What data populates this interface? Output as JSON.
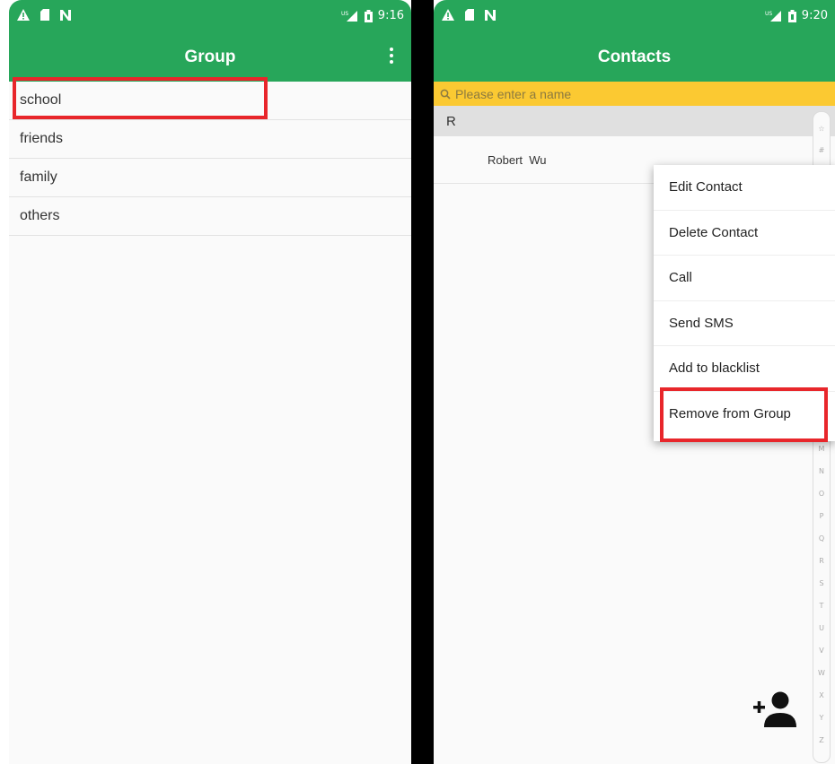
{
  "left_screen": {
    "status_bar": {
      "time": "9:16",
      "keyboard_indicator": "US",
      "icons": [
        "warning-icon",
        "sd-card-icon",
        "n-icon",
        "signal-icon",
        "battery-icon"
      ]
    },
    "app_bar": {
      "title": "Group",
      "menu_icon": "overflow-menu-icon"
    },
    "groups": [
      {
        "label": "school",
        "highlighted": true
      },
      {
        "label": "friends"
      },
      {
        "label": "family"
      },
      {
        "label": "others"
      }
    ]
  },
  "right_screen": {
    "status_bar": {
      "time": "9:20",
      "keyboard_indicator": "US"
    },
    "app_bar": {
      "title": "Contacts"
    },
    "search": {
      "placeholder": "Please enter a name"
    },
    "section_letter": "R",
    "contacts": [
      {
        "name": "Robert  Wu"
      }
    ],
    "context_menu": [
      {
        "label": "Edit Contact"
      },
      {
        "label": "Delete Contact"
      },
      {
        "label": "Call"
      },
      {
        "label": "Send SMS"
      },
      {
        "label": "Add to blacklist"
      },
      {
        "label": "Remove from Group",
        "highlighted": true
      }
    ],
    "index_letters": [
      "☆",
      "#",
      "M",
      "N",
      "O",
      "P",
      "Q",
      "R",
      "S",
      "T",
      "U",
      "V",
      "W",
      "X",
      "Y",
      "Z"
    ],
    "fab_icon": "add-person-icon"
  },
  "colors": {
    "primary": "#27a65a",
    "search_bg": "#fbc932",
    "highlight": "#e8262b"
  }
}
